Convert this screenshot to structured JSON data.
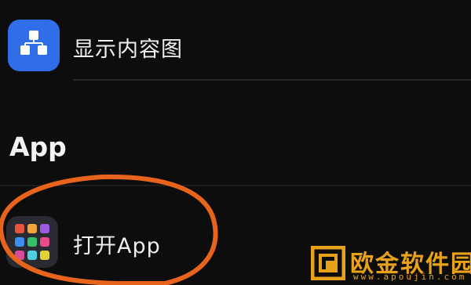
{
  "items": [
    {
      "label": "显示内容图",
      "icon": "hierarchy-icon",
      "color": "#2f6ee8"
    },
    {
      "label": "打开App",
      "icon": "app-grid-icon",
      "color": "#2a2b31"
    }
  ],
  "section": {
    "title": "App"
  },
  "highlight": {
    "color": "#e8641c"
  },
  "watermark": {
    "title": "欧金软件园",
    "url": "www.apoujin.com",
    "color": "#e8a21a"
  }
}
